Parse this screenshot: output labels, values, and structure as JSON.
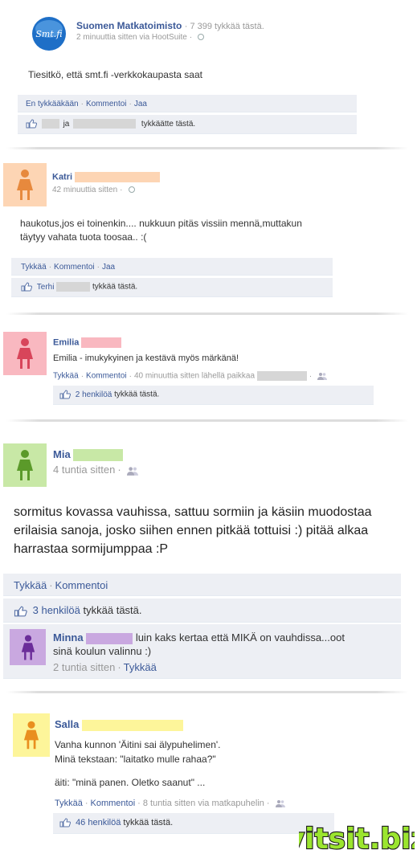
{
  "post1": {
    "page_name": "Suomen Matkatoimisto",
    "page_logo_text": "Smt.fi",
    "likes_count": "7 399 tykkää tästä.",
    "meta": "2 minuuttia sitten via HootSuite",
    "text": "Tiesitkö, että smt.fi -verkkokaupasta saat",
    "actions": [
      "En tykkääkään",
      "Kommentoi",
      "Jaa"
    ],
    "likes_mid": "ja",
    "likes_suffix": "tykkäätte tästä."
  },
  "post2": {
    "name": "Katri",
    "meta": "42 minuuttia sitten",
    "text_line1": "haukotus,jos ei toinenkin.... nukkuun pitäs vissiin mennä,muttakun",
    "text_line2": "täytyy vahata tuota toosaa.. :(",
    "actions": [
      "Tykkää",
      "Kommentoi",
      "Jaa"
    ],
    "liker": "Terhi",
    "likes_suffix": "tykkää tästä."
  },
  "post3": {
    "name": "Emilia",
    "text": "Emilia - imukykyinen ja kestävä myös märkänä!",
    "actions": [
      "Tykkää",
      "Kommentoi"
    ],
    "meta": "40 minuuttia sitten lähellä paikkaa",
    "likes_count": "2 henkilöä",
    "likes_suffix": "tykkää tästä."
  },
  "post4": {
    "name": "Mia",
    "meta": "4 tuntia sitten",
    "text_line1": "sormitus kovassa vauhissa, sattuu sormiin ja käsiin muodostaa",
    "text_line2": "erilaisia sanoja, josko siihen ennen pitkää tottuisi :) pitää alkaa",
    "text_line3": "harrastaa sormijumppaa :P",
    "actions": [
      "Tykkää",
      "Kommentoi"
    ],
    "likes_count": "3 henkilöä",
    "likes_suffix": "tykkää tästä.",
    "comment": {
      "name": "Minna",
      "text_line1": "luin kaks kertaa että MIKÄ on vauhdissa...oot",
      "text_line2": "sinä koulun valinnu :)",
      "meta": "2 tuntia sitten",
      "like_label": "Tykkää"
    }
  },
  "post5": {
    "name": "Salla",
    "text_line1": "Vanha kunnon 'Äitini sai älypuhelimen'.",
    "text_line2": "Minä tekstaan: \"laitatko mulle rahaa?\"",
    "text_line3": "äiti: \"minä panen. Oletko saanut\" ...",
    "actions": [
      "Tykkää",
      "Kommentoi"
    ],
    "meta": "8 tuntia sitten via matkapuhelin",
    "likes_count": "46 henkilöä",
    "likes_suffix": "tykkää tästä."
  },
  "watermark": "vitsit.biz",
  "colors": {
    "link": "#3b5998",
    "bar": "#edeff4",
    "avatar_katri": "#fdd5b4",
    "avatar_emilia": "#f9b8c0",
    "avatar_mia": "#c8e8a6",
    "avatar_minna": "#c9a8e0",
    "avatar_salla": "#fdf59a",
    "watermark_fill": "#9be52f"
  },
  "icons": [
    "smt-logo",
    "globe-icon",
    "thumbs-up-icon",
    "person-icon",
    "friends-icon"
  ]
}
